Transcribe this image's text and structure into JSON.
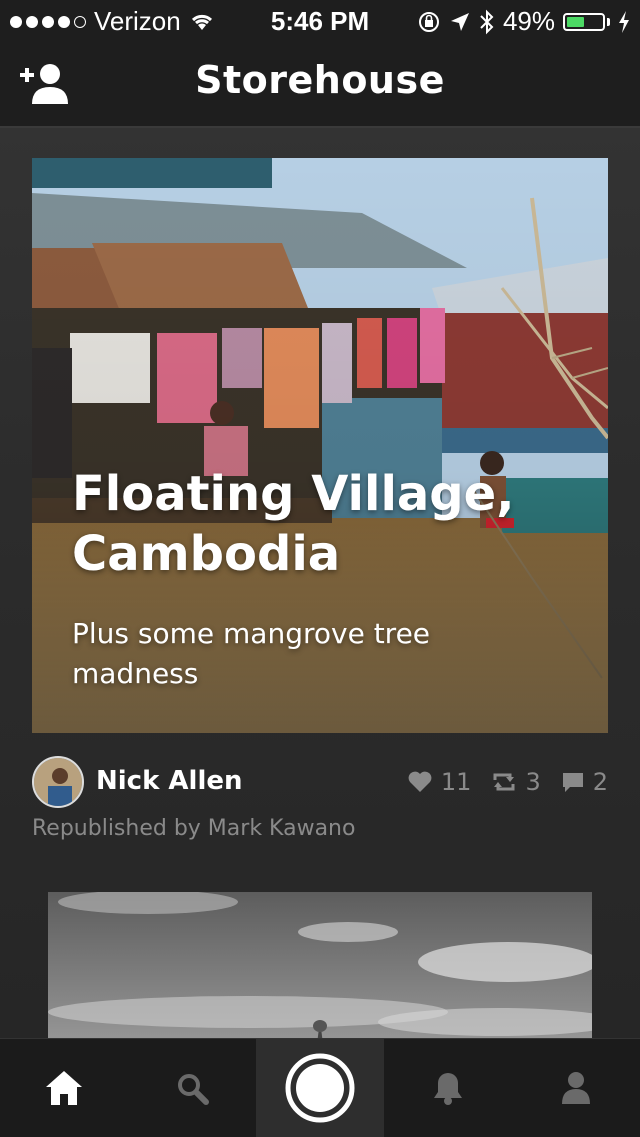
{
  "status_bar": {
    "carrier": "Verizon",
    "time": "5:46 PM",
    "battery": "49%",
    "battery_level": 0.49,
    "battery_color": "#4cd964"
  },
  "nav": {
    "title": "Storehouse",
    "add_user_icon": "add-user-icon"
  },
  "post": {
    "title": "Floating Village, Cambodia",
    "subtitle": "Plus some mangrove tree madness",
    "author": "Nick Allen",
    "republished_by": "Republished by Mark Kawano",
    "likes": "11",
    "reposts": "3",
    "comments": "2"
  },
  "tabbar": {
    "items": [
      {
        "icon": "home-icon",
        "active": true
      },
      {
        "icon": "search-icon",
        "active": false
      },
      {
        "icon": "camera-icon",
        "active": false
      },
      {
        "icon": "notifications-icon",
        "active": false
      },
      {
        "icon": "profile-icon",
        "active": false
      }
    ]
  }
}
